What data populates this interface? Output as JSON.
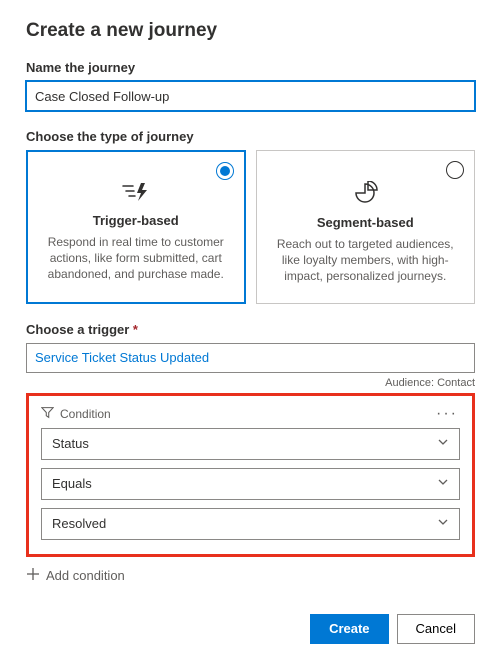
{
  "header": {
    "title": "Create a new journey"
  },
  "name": {
    "label": "Name the journey",
    "value": "Case Closed Follow-up"
  },
  "type": {
    "label": "Choose the type of journey",
    "options": {
      "trigger": {
        "title": "Trigger-based",
        "desc": "Respond in real time to customer actions, like form submitted, cart abandoned, and purchase made."
      },
      "segment": {
        "title": "Segment-based",
        "desc": "Reach out to targeted audiences, like loyalty members, with high-impact, personalized journeys."
      }
    }
  },
  "trigger": {
    "label": "Choose a trigger",
    "value": "Service Ticket Status Updated",
    "audience_label": "Audience: Contact"
  },
  "condition": {
    "heading": "Condition",
    "field": "Status",
    "operator": "Equals",
    "value": "Resolved"
  },
  "add_condition_label": "Add condition",
  "footer": {
    "create": "Create",
    "cancel": "Cancel"
  }
}
